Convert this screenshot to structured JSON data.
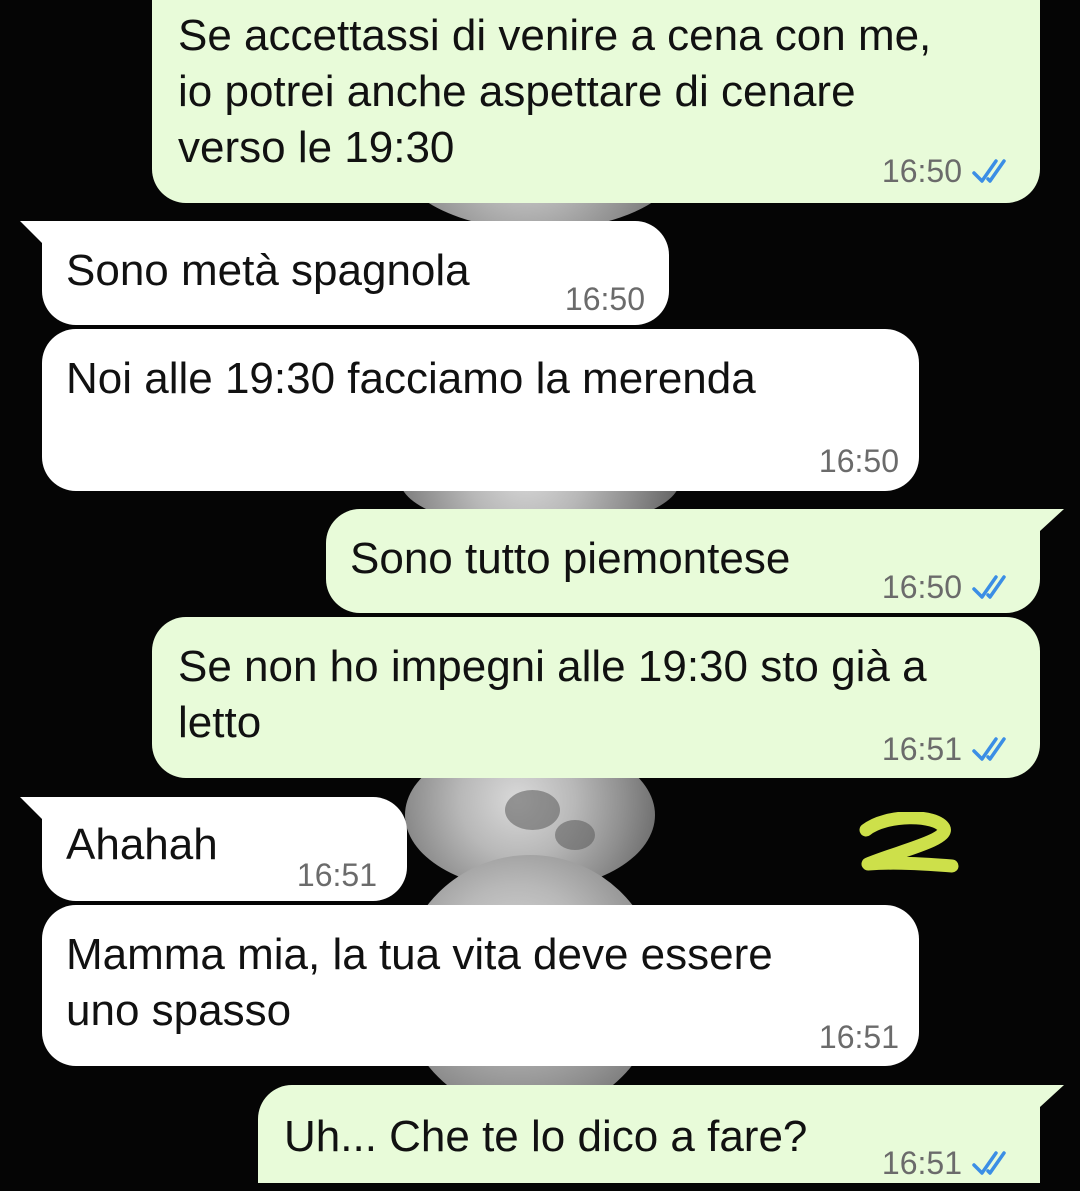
{
  "chat": {
    "messages": [
      {
        "direction": "sent",
        "text": "Se accettassi di venire a cena con me,\nio potrei anche aspettare di cenare\nverso le 19:30",
        "time": "16:50",
        "status": "read"
      },
      {
        "direction": "received",
        "text": "Sono metà spagnola",
        "time": "16:50"
      },
      {
        "direction": "received",
        "text": "Noi alle 19:30 facciamo la merenda",
        "time": "16:50"
      },
      {
        "direction": "sent",
        "text": "Sono tutto piemontese",
        "time": "16:50",
        "status": "read"
      },
      {
        "direction": "sent",
        "text": "Se non ho impegni alle 19:30 sto già a\nletto",
        "time": "16:51",
        "status": "read"
      },
      {
        "direction": "received",
        "text": "Ahahah",
        "time": "16:51"
      },
      {
        "direction": "received",
        "text": "Mamma mia, la tua vita deve essere\nuno spasso",
        "time": "16:51"
      },
      {
        "direction": "sent",
        "text": "Uh... Che te lo dico a fare?",
        "time": "16:51",
        "status": "read"
      }
    ],
    "annotation": {
      "label": "2",
      "color": "#cde04a"
    },
    "colors": {
      "background": "#050505",
      "sent_bubble": "#e8fbd9",
      "received_bubble": "#ffffff",
      "read_ticks": "#3b8ee5",
      "timestamp": "#6b6b6b"
    }
  }
}
